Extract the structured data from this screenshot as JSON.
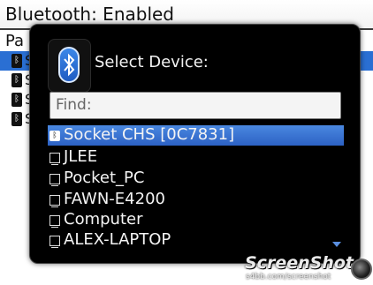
{
  "background": {
    "title": "Bluetooth: Enabled",
    "list_header": "Pa",
    "rows": [
      {
        "text": "S",
        "selected": true
      },
      {
        "text": "S",
        "selected": false
      },
      {
        "text": "S",
        "selected": false
      },
      {
        "text": "S",
        "selected": false
      }
    ]
  },
  "dialog": {
    "title": "Select Device:",
    "find_placeholder": "Find:",
    "devices": [
      {
        "label": "Socket CHS [0C7831]",
        "icon": "bluetooth-icon",
        "selected": true
      },
      {
        "label": "JLEE",
        "icon": "computer-icon",
        "selected": false
      },
      {
        "label": "Pocket_PC",
        "icon": "computer-icon",
        "selected": false
      },
      {
        "label": "FAWN-E4200",
        "icon": "computer-icon",
        "selected": false
      },
      {
        "label": "Computer",
        "icon": "computer-icon",
        "selected": false
      },
      {
        "label": "ALEX-LAPTOP",
        "icon": "computer-icon",
        "selected": false
      }
    ]
  },
  "watermark": {
    "title": "ScreenShot",
    "url": "s4bb.com/screenshot"
  },
  "colors": {
    "selection": "#2c61c4",
    "dialog_bg": "#000000"
  }
}
